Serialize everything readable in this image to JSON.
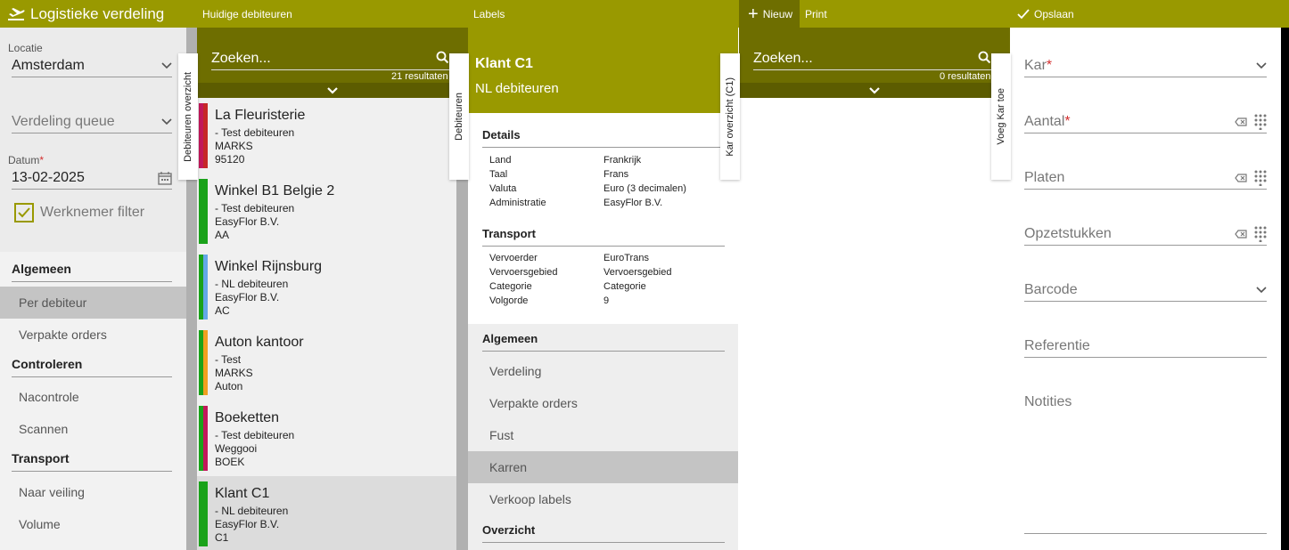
{
  "topbar": {
    "app_title": "Logistieke verdeling",
    "panel1_title": "Huidige debiteuren",
    "panel2_title": "Labels",
    "new_label": "Nieuw",
    "print_label": "Print",
    "save_label": "Opslaan"
  },
  "sidebar": {
    "locatie_label": "Locatie",
    "locatie_value": "Amsterdam",
    "queue_placeholder": "Verdeling queue",
    "datum_label": "Datum",
    "datum_value": "13-02-2025",
    "werknemer_filter": "Werknemer filter",
    "sections": [
      {
        "heading": "Algemeen",
        "items": [
          "Per debiteur",
          "Verpakte orders"
        ]
      },
      {
        "heading": "Controleren",
        "items": [
          "Nacontrole",
          "Scannen"
        ]
      },
      {
        "heading": "Transport",
        "items": [
          "Naar veiling",
          "Volume"
        ]
      }
    ],
    "active_item": "Per debiteur"
  },
  "vertical_tabs": {
    "debiteuren_overzicht": "Debiteuren overzicht",
    "debiteuren": "Debiteuren",
    "kar_overzicht": "Kar overzicht (C1)",
    "voeg_kar_toe": "Voeg Kar toe"
  },
  "debiteuren_search": {
    "placeholder": "Zoeken...",
    "result_count": "21 resultaten"
  },
  "debiteuren": [
    {
      "name": "La Fleuristerie",
      "group": "- Test debiteuren",
      "company": "MARKS",
      "code": "95120",
      "color1": "#c2185b",
      "color2": "#c62828",
      "selected": false
    },
    {
      "name": "Winkel B1 Belgie 2",
      "group": "- Test debiteuren",
      "company": "EasyFlor B.V.",
      "code": "AA",
      "color1": "#1aa21a",
      "color2": "#1aa21a",
      "selected": false
    },
    {
      "name": "Winkel Rijnsburg",
      "group": "- NL debiteuren",
      "company": "EasyFlor B.V.",
      "code": "AC",
      "color1": "#1aa21a",
      "color2": "#64a8e8",
      "selected": false
    },
    {
      "name": "Auton kantoor",
      "group": "- Test",
      "company": "MARKS",
      "code": "Auton",
      "color1": "#1aa21a",
      "color2": "#f0a020",
      "selected": false
    },
    {
      "name": "Boeketten",
      "group": "- Test debiteuren",
      "company": "Weggooi",
      "code": "BOEK",
      "color1": "#1aa21a",
      "color2": "#c2185b",
      "selected": false
    },
    {
      "name": "Klant C1",
      "group": "- NL debiteuren",
      "company": "EasyFlor B.V.",
      "code": "C1",
      "color1": "#1aa21a",
      "color2": "#1aa21a",
      "selected": true
    }
  ],
  "klant": {
    "name": "Klant C1",
    "subtitle": "NL debiteuren",
    "details_heading": "Details",
    "details": [
      {
        "k": "Land",
        "v": "Frankrijk"
      },
      {
        "k": "Taal",
        "v": "Frans"
      },
      {
        "k": "Valuta",
        "v": "Euro (3 decimalen)"
      },
      {
        "k": "Administratie",
        "v": "EasyFlor B.V."
      }
    ],
    "transport_heading": "Transport",
    "transport": [
      {
        "k": "Vervoerder",
        "v": "EuroTrans"
      },
      {
        "k": "Vervoersgebied",
        "v": "Vervoersgebied"
      },
      {
        "k": "Categorie",
        "v": "Categorie"
      },
      {
        "k": "Volgorde",
        "v": "9"
      }
    ],
    "menu_heading": "Algemeen",
    "menu": [
      "Verdeling",
      "Verpakte orders",
      "Fust",
      "Karren",
      "Verkoop labels"
    ],
    "active_menu": "Karren",
    "overzicht_heading": "Overzicht"
  },
  "kar_search": {
    "placeholder": "Zoeken...",
    "result_count": "0 resultaten"
  },
  "form": {
    "kar_label": "Kar",
    "aantal_label": "Aantal",
    "platen_label": "Platen",
    "opzetstukken_label": "Opzetstukken",
    "barcode_label": "Barcode",
    "referentie_label": "Referentie",
    "notities_label": "Notities"
  },
  "colors": {
    "brand": "#999900",
    "brand_dark": "#6e6e00",
    "required": "#d32f2f"
  }
}
